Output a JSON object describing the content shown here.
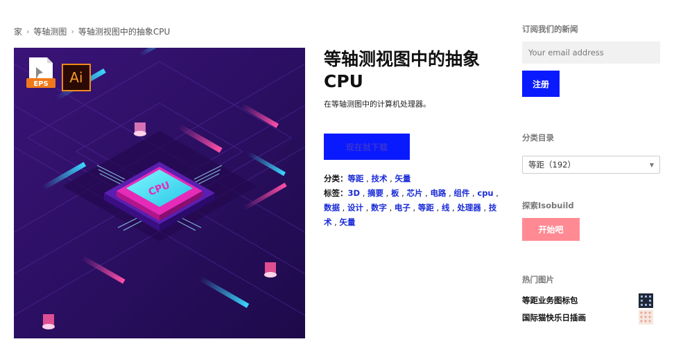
{
  "breadcrumb": {
    "home": "家",
    "category": "等轴测图",
    "current": "等轴测视图中的抽象CPU"
  },
  "product": {
    "title": "等轴测视图中的抽象CPU",
    "description": "在等轴测图中的计算机处理器。",
    "download_label": "现在就下载",
    "image_badges": {
      "eps": "EPS",
      "ai": "Ai",
      "chip_label": "CPU"
    },
    "categories_label": "分类：",
    "categories": [
      "等距",
      "技术",
      "矢量"
    ],
    "tags_label": "标签：",
    "tags": [
      "3D",
      "摘要",
      "板",
      "芯片",
      "电路",
      "组件",
      "cpu",
      "数据",
      "设计",
      "数字",
      "电子",
      "等距",
      "线",
      "处理器",
      "技术",
      "矢量"
    ]
  },
  "sidebar": {
    "newsletter_heading": "订阅我们的新闻",
    "email_placeholder": "Your email address",
    "signup_label": "注册",
    "categories_heading": "分类目录",
    "category_select_value": "等距（192）",
    "explore_heading": "探索Isobuild",
    "start_label": "开始吧",
    "popular_heading": "热门图片",
    "popular_items": [
      {
        "title": "等距业务图标包",
        "thumb_icon": "icon-pack-thumbnail"
      },
      {
        "title": "国际猫快乐日插画",
        "thumb_icon": "cat-illustration-thumbnail"
      }
    ]
  },
  "colors": {
    "accent_blue": "#0a1aff",
    "link_blue": "#1a2bd8",
    "pink_button": "#ff8a94",
    "hero_background": "#2a0f5e",
    "chip_cyan": "#2ee6f2",
    "chip_magenta": "#e52bb8"
  }
}
